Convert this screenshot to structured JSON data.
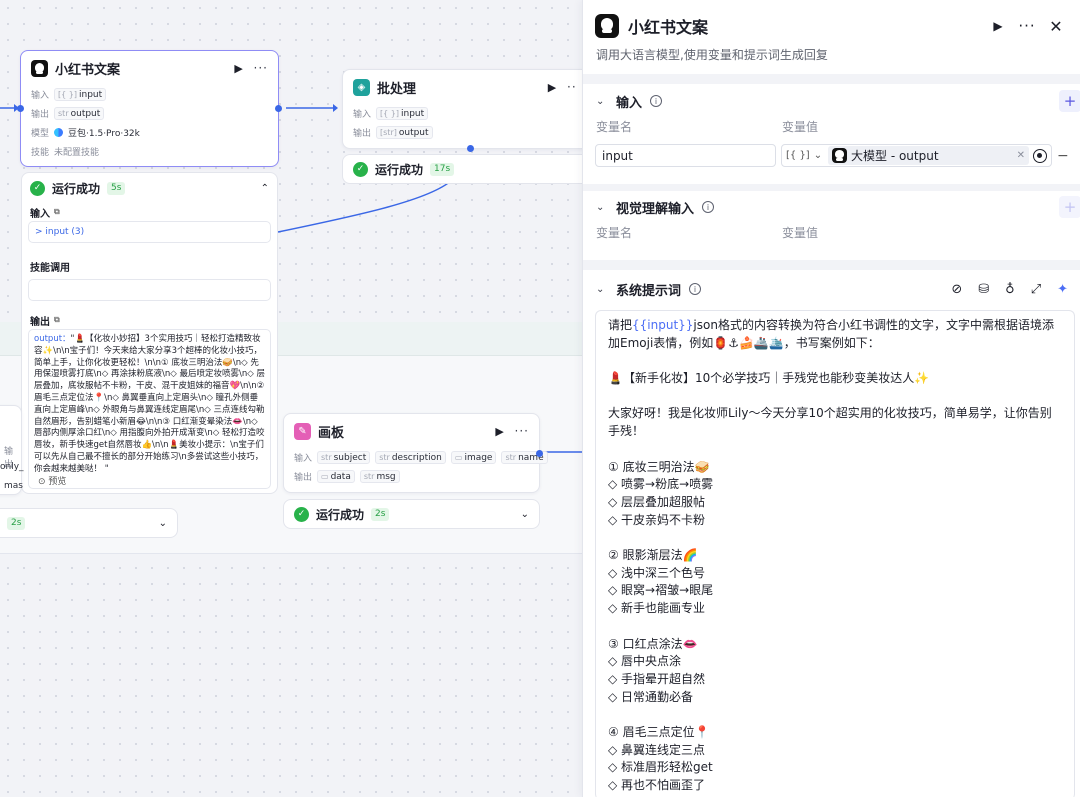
{
  "canvas": {
    "node_xhs": {
      "title": "小红书文案",
      "in_label": "输入",
      "in_type": "[{ }]",
      "in_val": "input",
      "out_label": "输出",
      "out_type": "str",
      "out_val": "output",
      "model_label": "模型",
      "model_val": "豆包·1.5·Pro·32k",
      "skill_label": "技能",
      "skill_val": "未配置技能"
    },
    "node_batch": {
      "title": "批处理",
      "in_label": "输入",
      "in_type": "[{ }]",
      "in_val": "input",
      "out_label": "输出",
      "out_type": "[str]",
      "out_val": "output",
      "status": "运行成功",
      "time": "17s"
    },
    "result": {
      "status": "运行成功",
      "time": "5s",
      "input_label": "输入",
      "input_val": "> input (3)",
      "skill_label": "技能调用",
      "output_label": "输出",
      "output_key": "output：",
      "output_text": "\"💄【化妆小妙招】3个实用技巧｜轻松打造精致妆容✨\\n\\n宝子们！今天来给大家分享3个超棒的化妆小技巧，简单上手，让你化妆更轻松！\\n\\n① 底妆三明治法🥪\\n◇ 先用保湿喷雾打底\\n◇ 再涂抹粉底液\\n◇ 最后喷定妆喷雾\\n◇ 层层叠加，底妆服帖不卡粉，干皮、混干皮姐妹的福音💖\\n\\n② 眉毛三点定位法📍\\n◇ 鼻翼垂直向上定眉头\\n◇ 瞳孔外侧垂直向上定眉峰\\n◇ 外眼角与鼻翼连线定眉尾\\n◇ 三点连线勾勒自然眉形，告别蜡笔小新眉😂\\n\\n③ 口红渐变晕染法👄\\n◇ 唇部内侧厚涂口红\\n◇ 用指腹向外拍开成渐变\\n◇ 轻松打造咬唇妆，新手快速get自然唇妆👍\\n\\n💄美妆小提示：\\n宝子们可以先从自己最不擅长的部分开始练习\\n多尝试这些小技巧，你会越来越美哒！ \"",
      "preview": "⊙ 预览"
    },
    "node_board": {
      "title": "画板",
      "in_label": "输入",
      "inputs": [
        {
          "type": "str",
          "name": "subject"
        },
        {
          "type": "str",
          "name": "description"
        },
        {
          "type": "▭",
          "name": "image"
        },
        {
          "type": "str",
          "name": "name"
        }
      ],
      "out_label": "输出",
      "outputs": [
        {
          "type": "▭",
          "name": "data"
        },
        {
          "type": "str",
          "name": "msg"
        }
      ],
      "status": "运行成功",
      "time": "2s"
    },
    "left_partial": {
      "out_label": "输出",
      "item1": "only_",
      "item2": "mas",
      "time": "2s"
    }
  },
  "panel": {
    "title": "小红书文案",
    "description": "调用大语言模型,使用变量和提示词生成回复",
    "input_section": {
      "title": "输入",
      "col_name": "变量名",
      "col_value": "变量值",
      "var_name": "input",
      "value_type": "[{ }]",
      "value_ref": "大模型 - output"
    },
    "visual_section": {
      "title": "视觉理解输入",
      "col_name": "变量名",
      "col_value": "变量值"
    },
    "prompt_section": {
      "title": "系统提示词",
      "prefix": "请把",
      "variable": "{{input}}",
      "suffix": "json格式的内容转换为符合小红书调性的文字，文字中需根据语境添加Emoji表情，例如🏮⚓🍰🚢🛳️，书写案例如下：",
      "lines": [
        "",
        "💄【新手化妆】10个必学技巧｜手残党也能秒变美妆达人✨",
        "",
        "大家好呀！我是化妆师Lily～今天分享10个超实用的化妆技巧，简单易学，让你告别手残！",
        "",
        "① 底妆三明治法🥪",
        "◇ 喷雾→粉底→喷雾",
        "◇ 层层叠加超服帖",
        "◇ 干皮亲妈不卡粉",
        "",
        "② 眼影渐层法🌈",
        "◇ 浅中深三个色号",
        "◇ 眼窝→褶皱→眼尾",
        "◇ 新手也能画专业",
        "",
        "③ 口红点涂法👄",
        "◇ 唇中央点涂",
        "◇ 手指晕开超自然",
        "◇ 日常通勤必备",
        "",
        "④ 眉毛三点定位📍",
        "◇ 鼻翼连线定三点",
        "◇ 标准眉形轻松get",
        "◇ 再也不怕画歪了"
      ]
    }
  }
}
